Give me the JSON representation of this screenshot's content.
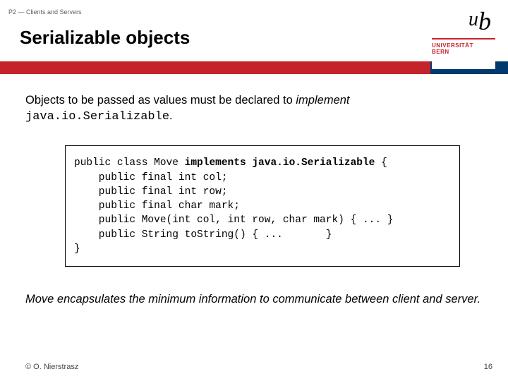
{
  "header": {
    "breadcrumb": "P2 — Clients and Servers",
    "title": "Serializable objects",
    "logo": {
      "u": "u",
      "b": "b",
      "line1": "UNIVERSITÄT",
      "line2": "BERN"
    }
  },
  "body": {
    "intro_pre": "Objects to be passed as values must be declared to ",
    "intro_em": "implement",
    "intro_code": "java.io.Serializable",
    "intro_post": ".",
    "code": {
      "l1a": "public class Move ",
      "l1b": "implements java.io.Serializable",
      "l1c": " {",
      "l2": "    public final int col;",
      "l3": "    public final int row;",
      "l4": "    public final char mark;",
      "l5": "    public Move(int col, int row, char mark) { ... }",
      "l6": "    public String toString() { ...       }",
      "l7": "}"
    },
    "outro": "Move encapsulates the minimum information to communicate between client and server."
  },
  "footer": {
    "copyright": "© O. Nierstrasz",
    "page": "16"
  }
}
